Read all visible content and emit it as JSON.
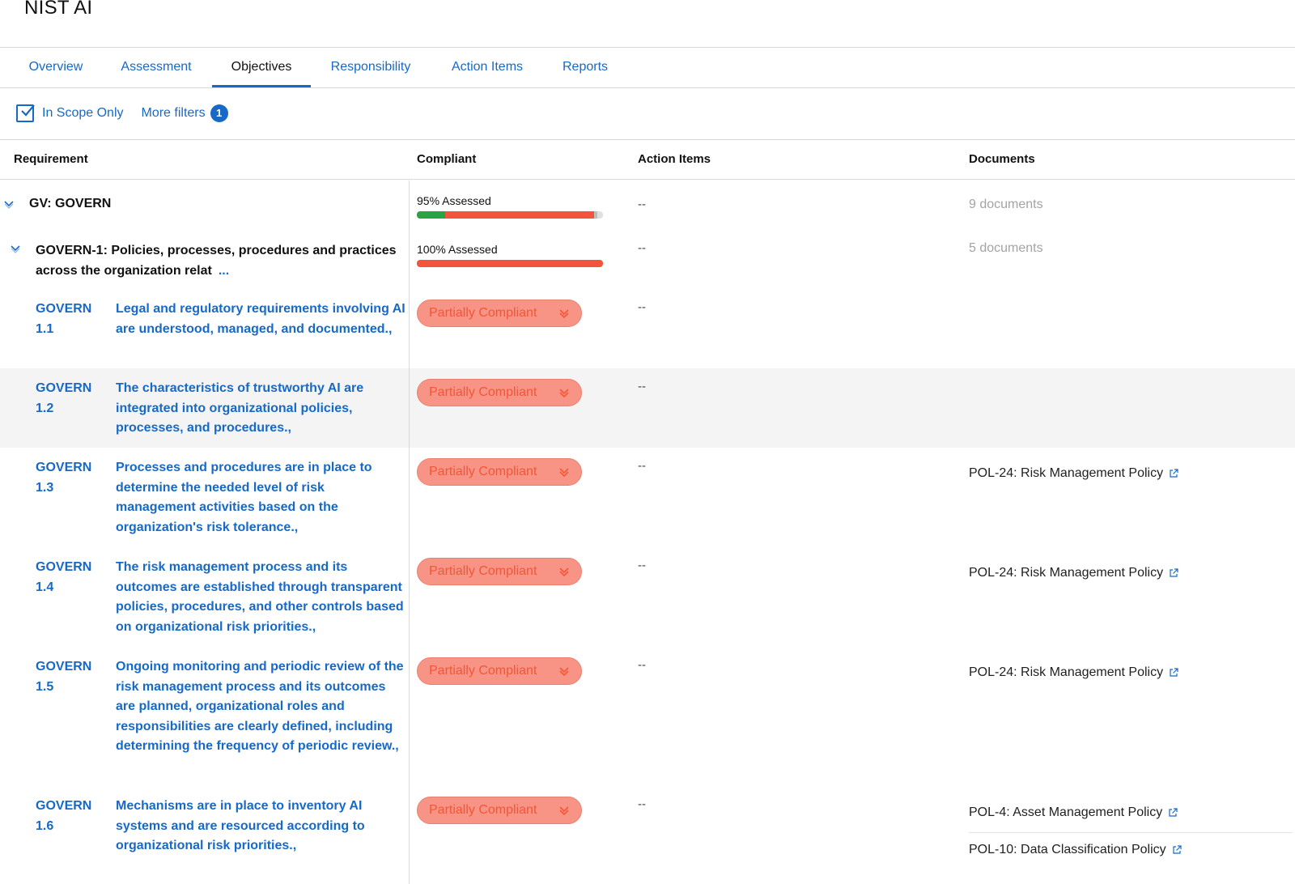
{
  "app": {
    "title": "NIST AI"
  },
  "tabs": [
    {
      "label": "Overview"
    },
    {
      "label": "Assessment"
    },
    {
      "label": "Objectives"
    },
    {
      "label": "Responsibility"
    },
    {
      "label": "Action Items"
    },
    {
      "label": "Reports"
    }
  ],
  "active_tab": "Objectives",
  "filters": {
    "in_scope_label": "In Scope Only",
    "in_scope_checked": true,
    "more_filters_label": "More filters",
    "more_filters_count": "1"
  },
  "table": {
    "headers": {
      "requirement": "Requirement",
      "compliant": "Compliant",
      "action_items": "Action Items",
      "documents": "Documents"
    },
    "group": {
      "name": "GV: GOVERN",
      "assessed_label": "95% Assessed",
      "progress": {
        "compliant_pct": 15,
        "noncompliant_pct": 80,
        "other_pct": 2,
        "unassessed_pct": 3
      },
      "action_items": "--",
      "documents": "9 documents"
    },
    "subgroup": {
      "name_line1": "GOVERN-1: Policies, processes, procedures and practices",
      "name_line2": "across the organization relat",
      "ellipsis": "...",
      "assessed_label": "100% Assessed",
      "progress": {
        "compliant_pct": 0,
        "noncompliant_pct": 100,
        "other_pct": 0,
        "unassessed_pct": 0
      },
      "action_items": "--",
      "documents": "5 documents"
    },
    "rows": [
      {
        "id_line1": "GOVERN",
        "id_line2": "1.1",
        "text": "Legal and regulatory requirements involving AI are understood, managed, and documented.,",
        "status": "Partially Compliant",
        "action_items": "--",
        "documents": []
      },
      {
        "id_line1": "GOVERN",
        "id_line2": "1.2",
        "text": "The characteristics of trustworthy AI are integrated into organizational policies, processes, and procedures.,",
        "status": "Partially Compliant",
        "action_items": "--",
        "documents": []
      },
      {
        "id_line1": "GOVERN",
        "id_line2": "1.3",
        "text": "Processes and procedures are in place to determine the needed level of risk management activities based on the organization's risk tolerance.,",
        "status": "Partially Compliant",
        "action_items": "--",
        "documents": [
          "POL-24: Risk Management Policy"
        ]
      },
      {
        "id_line1": "GOVERN",
        "id_line2": "1.4",
        "text": "The risk management process and its outcomes are established through transparent policies, procedures, and other controls based on organizational risk priorities.,",
        "status": "Partially Compliant",
        "action_items": "--",
        "documents": [
          "POL-24: Risk Management Policy"
        ]
      },
      {
        "id_line1": "GOVERN",
        "id_line2": "1.5",
        "text": "Ongoing monitoring and periodic review of the risk management process and its outcomes are planned, organizational roles and responsibilities are clearly defined, including determining the frequency of periodic review.,",
        "status": "Partially Compliant",
        "action_items": "--",
        "documents": [
          "POL-24: Risk Management Policy"
        ]
      },
      {
        "id_line1": "GOVERN",
        "id_line2": "1.6",
        "text": "Mechanisms are in place to inventory AI systems and are resourced according to organizational risk priorities.,",
        "status": "Partially Compliant",
        "action_items": "--",
        "documents": [
          "POL-4: Asset Management Policy",
          "POL-10: Data Classification Policy"
        ]
      }
    ]
  },
  "colors": {
    "accent": "#1769c7",
    "compliant": "#2aa345",
    "noncompliant": "#f2553b",
    "other": "#bdbdbd",
    "partial_pill_bg": "#f89486",
    "partial_pill_text": "#f35636"
  },
  "icons": {
    "checkbox": "checkmark-icon",
    "caret": "chevron-down-icon",
    "status_dropdown": "double-chevron-down-icon",
    "external": "external-link-icon"
  }
}
